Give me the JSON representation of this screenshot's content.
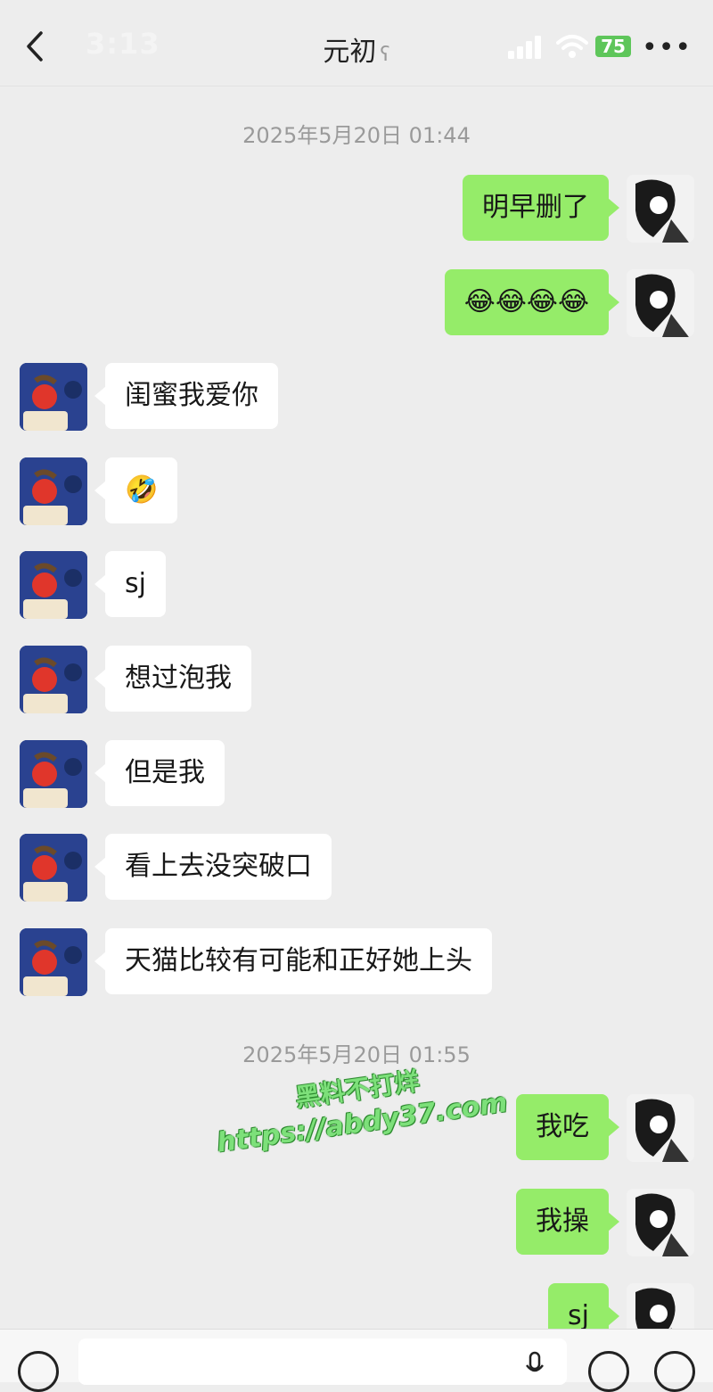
{
  "status_bar": {
    "time": "3:13",
    "battery": "75",
    "more": "•••"
  },
  "header": {
    "title": "元初",
    "ear_icon": "ear-icon"
  },
  "timestamps": [
    "2025年5月20日 01:44",
    "2025年5月20日 01:55"
  ],
  "messages": [
    {
      "from": "me",
      "text": "明早删了"
    },
    {
      "from": "me",
      "text": "😂😂😂😂"
    },
    {
      "from": "her",
      "text": "闺蜜我爱你"
    },
    {
      "from": "her",
      "text": "🤣"
    },
    {
      "from": "her",
      "text": "sj"
    },
    {
      "from": "her",
      "text": "想过泡我"
    },
    {
      "from": "her",
      "text": "但是我"
    },
    {
      "from": "her",
      "text": "看上去没突破口"
    },
    {
      "from": "her",
      "text": "天猫比较有可能和正好她上头"
    },
    {
      "from": "me",
      "text": "我吃"
    },
    {
      "from": "me",
      "text": "我操"
    },
    {
      "from": "me",
      "text": "sj"
    }
  ],
  "watermark": {
    "line1": "黑料不打烊",
    "line2": "https://abdy37.com"
  },
  "colors": {
    "my_bubble": "#95ec69",
    "their_bubble": "#ffffff",
    "background": "#ededed",
    "battery": "#5ec65a"
  }
}
